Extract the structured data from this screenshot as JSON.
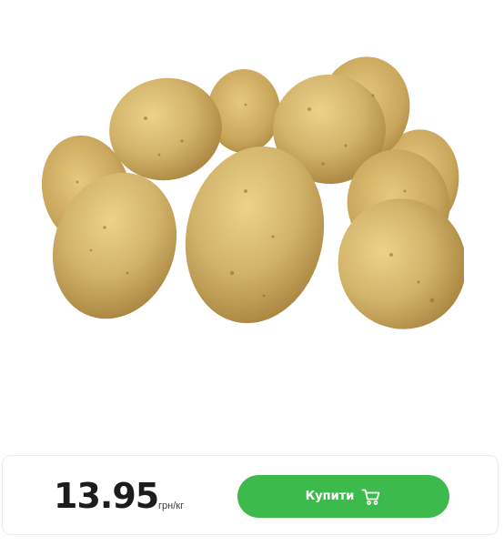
{
  "product": {
    "image_alt": "potatoes"
  },
  "price": {
    "value": "13.95",
    "unit": "грн/кг"
  },
  "buy_button": {
    "label": "Купити",
    "icon": "cart-icon"
  },
  "colors": {
    "button_green": "#3dba4c",
    "price_text": "#1c1c1c",
    "potato_skin": "#d2b36a"
  }
}
